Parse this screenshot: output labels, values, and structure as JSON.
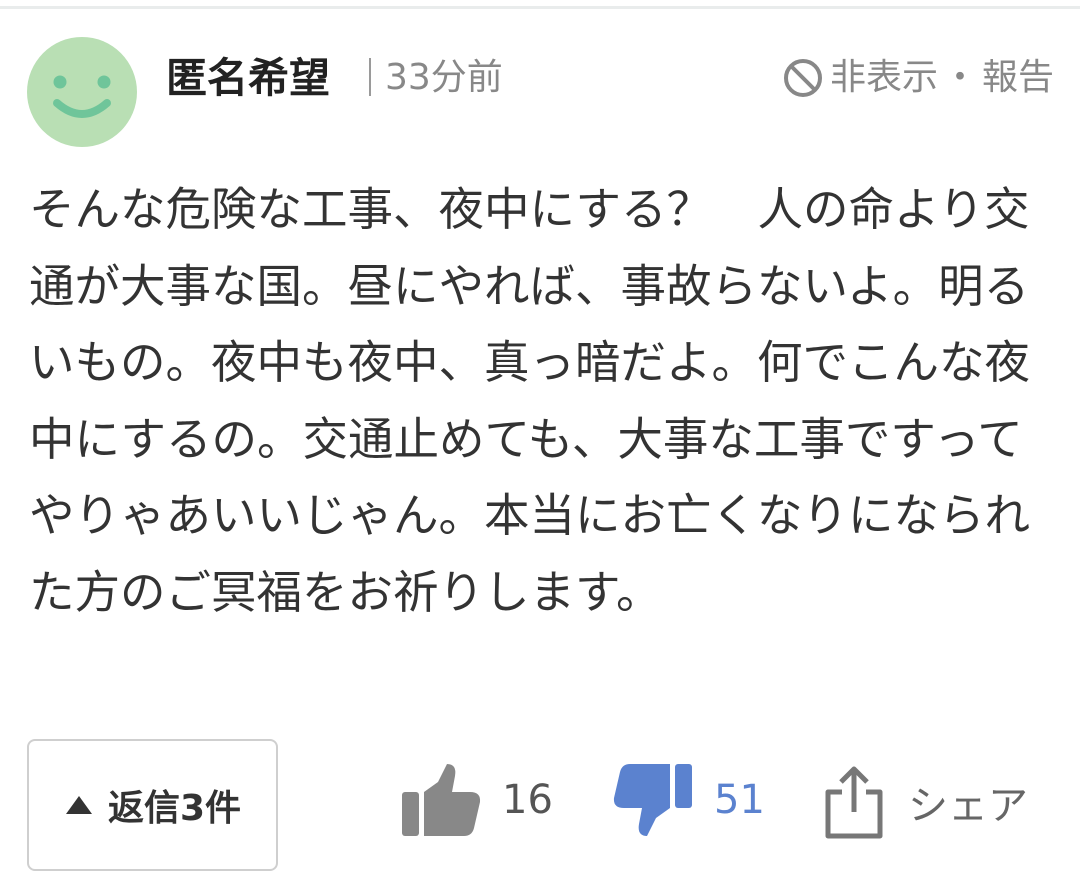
{
  "comment": {
    "username": "匿名希望",
    "time_ago": "33分前",
    "hide_label": "非表示",
    "separator_dot": "・",
    "report_label": "報告",
    "avatar_icon": "smiley-face-icon",
    "avatar_color": "#b9dfb4",
    "avatar_feature_color": "#6fc59a",
    "body": "そんな危険な工事、夜中にする？　人の命より交通が大事な国。昼にやれば、事故らないよ。明るいもの。夜中も夜中、真っ暗だよ。何でこんな夜中にするの。交通止めても、大事な工事ですってやりゃあいいじゃん。本当にお亡くなりになられた方のご冥福をお祈りします。"
  },
  "actions": {
    "replies_label": "返信3件",
    "replies_icon": "triangle-up-icon",
    "like_icon": "thumbs-up-icon",
    "like_count": "16",
    "like_color": "#888888",
    "dislike_icon": "thumbs-down-icon",
    "dislike_count": "51",
    "dislike_color": "#5b82cf",
    "share_icon": "share-icon",
    "share_label": "シェア"
  }
}
